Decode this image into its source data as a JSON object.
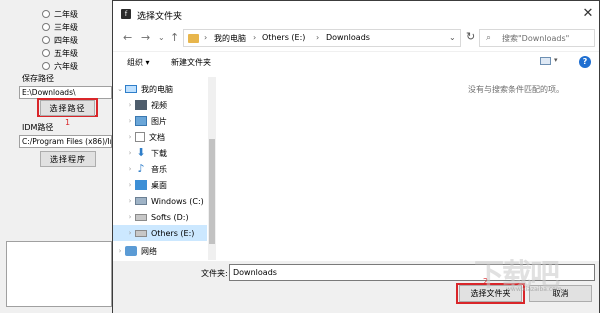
{
  "app": {
    "grades": [
      "二年级",
      "三年级",
      "四年级",
      "五年级",
      "六年级"
    ],
    "save_path_label": "保存路径",
    "save_path_value": "E:\\Downloads\\",
    "choose_path_button": "选择路径",
    "annotation_1": "1",
    "idm_path_label": "IDM路径",
    "idm_path_value": "C:/Program Files (x86)/Ir",
    "choose_program_button": "选择程序"
  },
  "dialog": {
    "title": "选择文件夹",
    "close": "✕",
    "nav": {
      "back": "←",
      "forward": "→",
      "recent": "⌄",
      "up": "↑"
    },
    "breadcrumbs": [
      "我的电脑",
      "Others (E:)",
      "Downloads"
    ],
    "search_placeholder": "搜索\"Downloads\"",
    "toolbar": {
      "organize": "组织 ▾",
      "new_folder": "新建文件夹",
      "help": "?"
    },
    "tree": [
      {
        "label": "我的电脑",
        "icon": "computer-icon"
      },
      {
        "label": "视频",
        "icon": "video-icon"
      },
      {
        "label": "图片",
        "icon": "pictures-icon"
      },
      {
        "label": "文档",
        "icon": "documents-icon"
      },
      {
        "label": "下载",
        "icon": "download-icon"
      },
      {
        "label": "音乐",
        "icon": "music-icon"
      },
      {
        "label": "桌面",
        "icon": "desktop-icon"
      },
      {
        "label": "Windows (C:)",
        "icon": "drive-icon"
      },
      {
        "label": "Softs (D:)",
        "icon": "drive-icon"
      },
      {
        "label": "Others (E:)",
        "icon": "drive-icon"
      },
      {
        "label": "网络",
        "icon": "network-icon"
      }
    ],
    "empty_message": "没有与搜索条件匹配的项。",
    "folder_label": "文件夹:",
    "folder_value": "Downloads",
    "select_folder_button": "选择文件夹",
    "cancel_button": "取消",
    "annotation_2": "2."
  },
  "watermark": {
    "text": "下载吧",
    "url": "www.xiazaiba.com"
  },
  "colors": {
    "highlight_red": "#d9262a",
    "selection_blue": "#cce8ff",
    "help_blue": "#1f6fd1"
  }
}
